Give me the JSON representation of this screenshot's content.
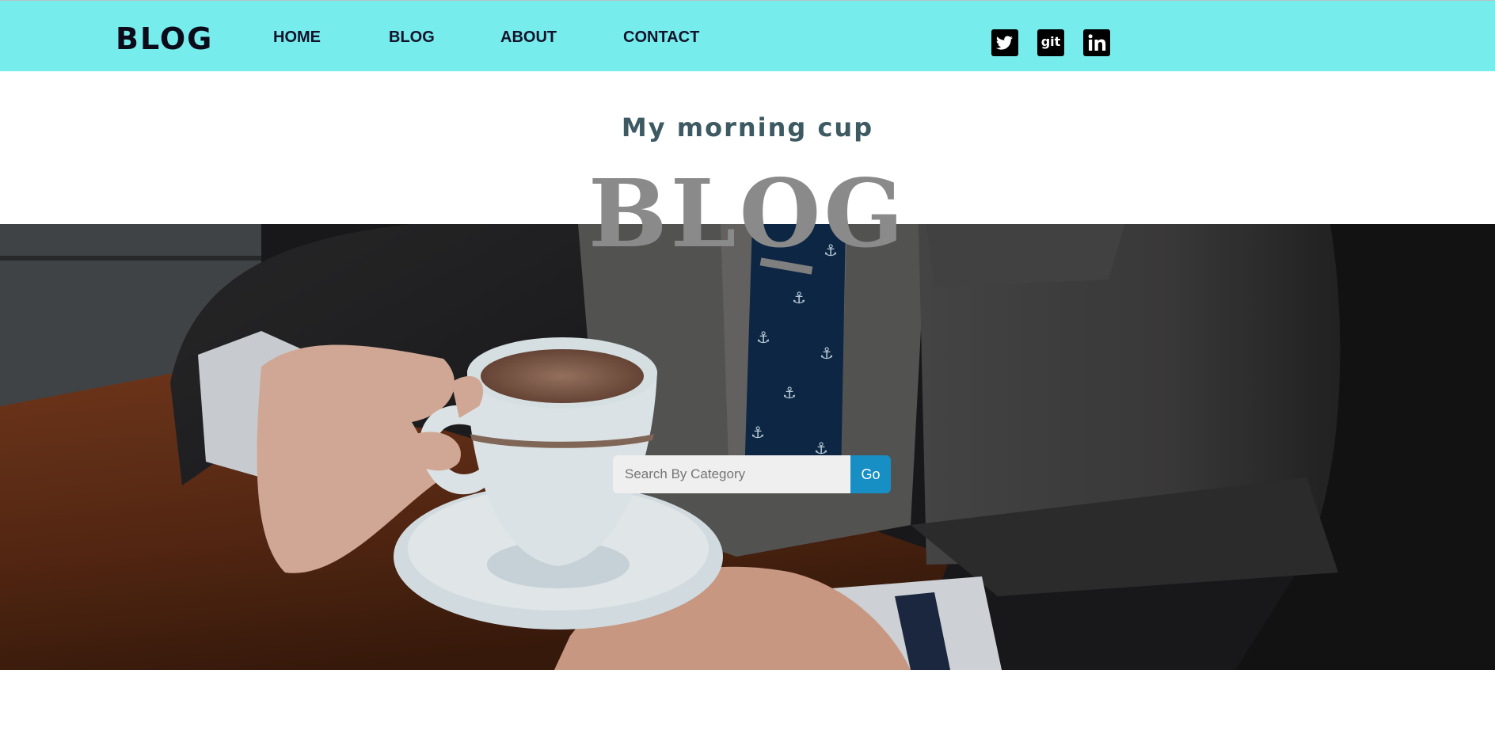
{
  "brand": "BLOG",
  "nav": {
    "home": "HOME",
    "blog": "BLOG",
    "about": "ABOUT",
    "contact": "CONTACT"
  },
  "social": {
    "twitter_icon": "twitter-icon",
    "git_label": "git",
    "linkedin_icon": "linkedin-icon"
  },
  "hero": {
    "subtitle": "My morning cup",
    "title": "BLOG"
  },
  "search": {
    "placeholder": "Search By Category",
    "button_label": "Go"
  },
  "colors": {
    "navbar": "#76ecec",
    "accent_button": "#178fc5",
    "subtitle": "#3d5962",
    "title": "#8a8a8a"
  }
}
